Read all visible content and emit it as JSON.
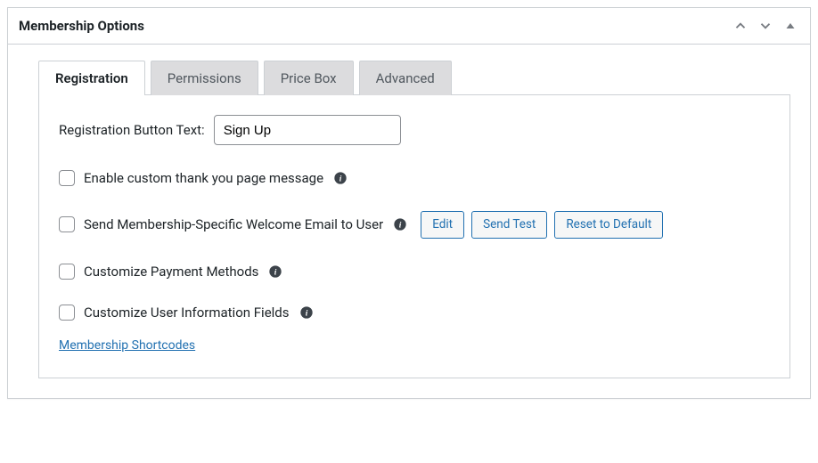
{
  "metabox": {
    "title": "Membership Options"
  },
  "tabs": {
    "registration": "Registration",
    "permissions": "Permissions",
    "price_box": "Price Box",
    "advanced": "Advanced"
  },
  "fields": {
    "reg_button_label": "Registration Button Text:",
    "reg_button_value": "Sign Up",
    "thank_you_label": "Enable custom thank you page message",
    "welcome_email_label": "Send Membership-Specific Welcome Email to User",
    "payment_methods_label": "Customize Payment Methods",
    "user_info_label": "Customize User Information Fields"
  },
  "buttons": {
    "edit": "Edit",
    "send_test": "Send Test",
    "reset": "Reset to Default"
  },
  "link": {
    "shortcodes": "Membership Shortcodes"
  }
}
